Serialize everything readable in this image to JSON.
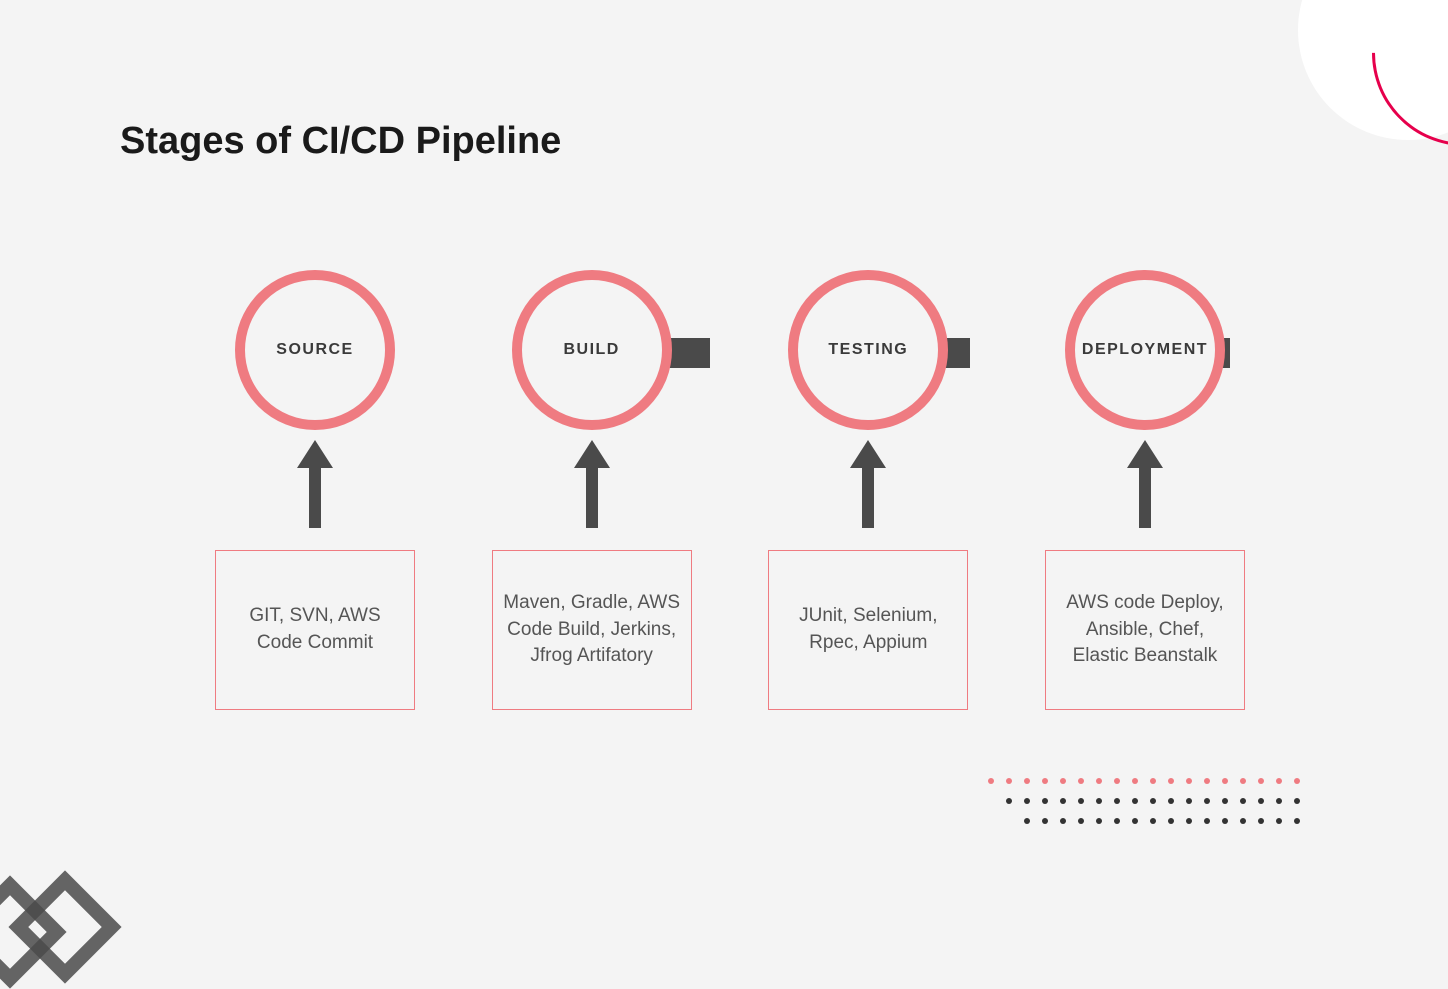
{
  "title": "Stages of CI/CD Pipeline",
  "stages": [
    {
      "name": "SOURCE",
      "tools": "GIT, SVN, AWS Code Commit"
    },
    {
      "name": "BUILD",
      "tools": "Maven, Gradle, AWS Code Build, Jerkins, Jfrog Artifatory"
    },
    {
      "name": "TESTING",
      "tools": "JUnit, Selenium, Rpec, Appium"
    },
    {
      "name": "DEPLOYMENT",
      "tools": "AWS code Deploy, Ansible, Chef, Elastic Beanstalk"
    }
  ]
}
